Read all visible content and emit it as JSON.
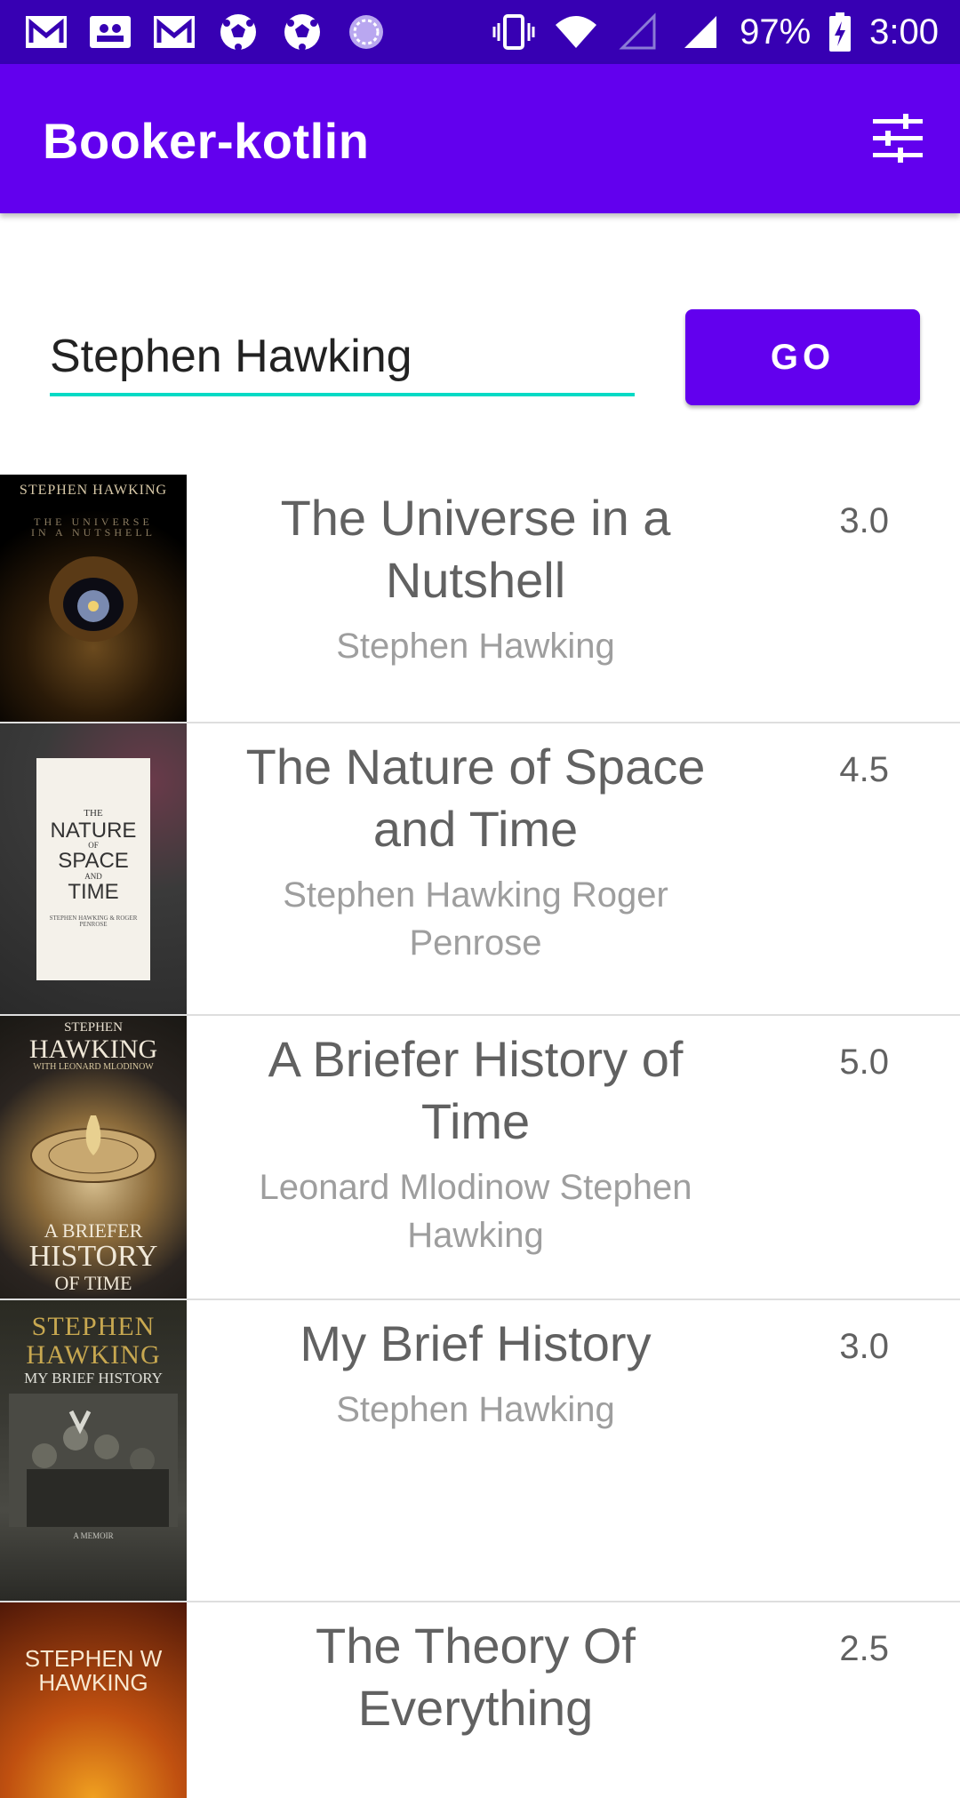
{
  "status_bar": {
    "left_icons": [
      "gmail-icon",
      "contacts-icon",
      "gmail-icon",
      "soccer-ball-icon",
      "soccer-ball-icon",
      "sync-icon"
    ],
    "battery_pct": "97%",
    "time": "3:00"
  },
  "app_bar": {
    "title": "Booker-kotlin",
    "filter_icon": "tune-icon"
  },
  "search": {
    "value": "Stephen Hawking",
    "button_label": "GO"
  },
  "books": [
    {
      "title": "The Universe in a Nutshell",
      "author": "Stephen Hawking",
      "rating": "3.0",
      "cover_text": [
        "STEPHEN HAWKING",
        "THE UNIVERSE IN A NUTSHELL"
      ]
    },
    {
      "title": "The Nature of Space and Time",
      "author": "Stephen Hawking Roger Penrose",
      "rating": "4.5",
      "cover_text": [
        "THE",
        "NATURE",
        "OF",
        "SPACE",
        "AND",
        "TIME",
        "STEPHEN HAWKING & ROGER PENROSE"
      ]
    },
    {
      "title": "A Briefer History of Time",
      "author": "Leonard Mlodinow Stephen Hawking",
      "rating": "5.0",
      "cover_text": [
        "STEPHEN",
        "HAWKING",
        "WITH LEONARD MLODINOW",
        "A BRIEFER",
        "HISTORY",
        "OF TIME"
      ]
    },
    {
      "title": "My Brief History",
      "author": "Stephen Hawking",
      "rating": "3.0",
      "cover_text": [
        "STEPHEN",
        "HAWKING",
        "MY BRIEF HISTORY",
        "A MEMOIR"
      ]
    },
    {
      "title": "The Theory Of Everything",
      "author": "",
      "rating": "2.5",
      "cover_text": [
        "STEPHEN W",
        "HAWKING"
      ]
    }
  ]
}
